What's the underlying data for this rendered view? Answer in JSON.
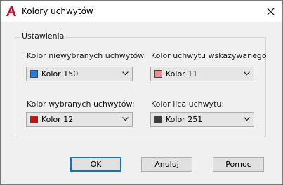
{
  "window": {
    "title": "Kolory uchwytów",
    "close_glyph": "✕"
  },
  "group": {
    "title": "Ustawienia",
    "fields": [
      {
        "label": "Kolor niewybranych uchwytów:",
        "value": "Kolor 150",
        "swatch_color": "#1e7ee6"
      },
      {
        "label": "Kolor uchwytu wskazywanego:",
        "value": "Kolor 11",
        "swatch_color": "#f08c8c"
      },
      {
        "label": "Kolor wybranych uchwytów:",
        "value": "Kolor 12",
        "swatch_color": "#cc1111"
      },
      {
        "label": "Kolor lica uchwytu:",
        "value": "Kolor 251",
        "swatch_color": "#3c3c3c"
      }
    ]
  },
  "buttons": {
    "ok": "OK",
    "cancel": "Anuluj",
    "help": "Pomoc"
  },
  "icons": {
    "app": "autocad-logo-icon",
    "close": "close-icon",
    "dropdown": "chevron-down-icon"
  },
  "colors": {
    "accent": "#0078d7",
    "logo_red": "#c8102e"
  }
}
